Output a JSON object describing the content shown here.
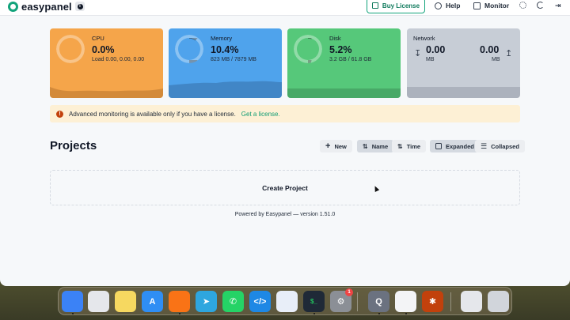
{
  "header": {
    "brand": "easypanel",
    "buy_license": "Buy License",
    "help": "Help",
    "monitor": "Monitor"
  },
  "stats": {
    "cpu": {
      "label": "CPU",
      "value": "0.0%",
      "sub": "Load 0.00, 0.00, 0.00",
      "color": "#f5a54a",
      "level": 0.0
    },
    "memory": {
      "label": "Memory",
      "value": "10.4%",
      "sub": "823 MB / 7879 MB",
      "color": "#4fa3ec",
      "level": 0.104
    },
    "disk": {
      "label": "Disk",
      "value": "5.2%",
      "sub": "3.2 GB / 61.8 GB",
      "color": "#56c87a",
      "level": 0.052
    },
    "network": {
      "label": "Network",
      "down_value": "0.00",
      "down_unit": "MB",
      "up_value": "0.00",
      "up_unit": "MB",
      "color": "#c7cdd6"
    }
  },
  "alert": {
    "text": "Advanced monitoring is available only if you have a license.",
    "link": "Get a license."
  },
  "projects": {
    "title": "Projects",
    "new_label": "New",
    "sort_name": "Name",
    "sort_time": "Time",
    "view_expanded": "Expanded",
    "view_collapsed": "Collapsed",
    "create_label": "Create Project"
  },
  "footer": {
    "text": "Powered by Easypanel — version 1.51.0"
  },
  "dock": {
    "apps": [
      {
        "name": "finder",
        "color": "#3b82f6"
      },
      {
        "name": "launchpad",
        "color": "#e5e7eb"
      },
      {
        "name": "notes",
        "color": "#f6d860"
      },
      {
        "name": "app-store",
        "color": "#2f8ef4"
      },
      {
        "name": "brave",
        "color": "#f97316"
      },
      {
        "name": "telegram",
        "color": "#2ea6df"
      },
      {
        "name": "whatsapp",
        "color": "#25d366"
      },
      {
        "name": "vscode",
        "color": "#1e88e5"
      },
      {
        "name": "mail-app",
        "color": "#e8eef8"
      },
      {
        "name": "terminal",
        "color": "#1f2937"
      },
      {
        "name": "system-settings",
        "color": "#8b8f96"
      },
      {
        "name": "quicktime",
        "color": "#6b7280"
      },
      {
        "name": "chrome",
        "color": "#f3f4f6"
      },
      {
        "name": "perplexity",
        "color": "#c2410c"
      },
      {
        "name": "document",
        "color": "#e5e7eb"
      },
      {
        "name": "trash",
        "color": "#d1d5db"
      }
    ],
    "settings_badge": "1"
  }
}
